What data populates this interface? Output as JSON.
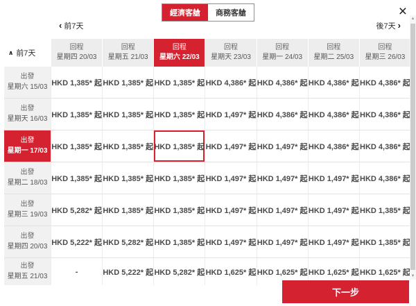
{
  "modal": {
    "tabs": {
      "economy": "經濟客艙",
      "business": "商務客艙"
    },
    "close_icon": "×",
    "nav": {
      "prev_icon": "‹",
      "prev_label": "前7天",
      "next_label": "後7天",
      "next_icon": "›"
    },
    "corner": {
      "collapse_icon": "∧",
      "label": "前7天"
    },
    "next_button_label": "下一步"
  },
  "fare_table": {
    "columns": [
      {
        "type": "回程",
        "date": "星期四 20/03"
      },
      {
        "type": "回程",
        "date": "星期五 21/03"
      },
      {
        "type": "回程",
        "date": "星期六 22/03"
      },
      {
        "type": "回程",
        "date": "星期天 23/03"
      },
      {
        "type": "回程",
        "date": "星期一 24/03"
      },
      {
        "type": "回程",
        "date": "星期二 25/03"
      },
      {
        "type": "回程",
        "date": "星期三 26/03"
      }
    ],
    "rows": [
      {
        "type": "出發",
        "date": "星期六 15/03",
        "prices": [
          "HKD 1,385* 起",
          "HKD 1,385* 起",
          "HKD 1,385* 起",
          "HKD 4,386* 起",
          "HKD 4,386* 起",
          "HKD 4,386* 起",
          "HKD 4,386* 起"
        ]
      },
      {
        "type": "出發",
        "date": "星期天 16/03",
        "prices": [
          "HKD 1,385* 起",
          "HKD 1,385* 起",
          "HKD 1,385* 起",
          "HKD 1,497* 起",
          "HKD 4,386* 起",
          "HKD 4,386* 起",
          "HKD 4,386* 起"
        ]
      },
      {
        "type": "出發",
        "date": "星期一 17/03",
        "prices": [
          "HKD 1,385* 起",
          "HKD 1,385* 起",
          "HKD 1,385* 起",
          "HKD 1,497* 起",
          "HKD 1,497* 起",
          "HKD 4,386* 起",
          "HKD 4,386* 起"
        ]
      },
      {
        "type": "出發",
        "date": "星期二 18/03",
        "prices": [
          "HKD 1,385* 起",
          "HKD 1,385* 起",
          "HKD 1,385* 起",
          "HKD 1,497* 起",
          "HKD 1,497* 起",
          "HKD 1,497* 起",
          "HKD 4,386* 起"
        ]
      },
      {
        "type": "出發",
        "date": "星期三 19/03",
        "prices": [
          "HKD 5,282* 起",
          "HKD 1,385* 起",
          "HKD 1,385* 起",
          "HKD 1,497* 起",
          "HKD 1,497* 起",
          "HKD 1,497* 起",
          "HKD 1,385* 起"
        ]
      },
      {
        "type": "出發",
        "date": "星期四 20/03",
        "prices": [
          "HKD 5,222* 起",
          "HKD 5,282* 起",
          "HKD 1,385* 起",
          "HKD 1,497* 起",
          "HKD 1,497* 起",
          "HKD 1,497* 起",
          "HKD 1,385* 起"
        ]
      },
      {
        "type": "出發",
        "date": "星期五 21/03",
        "prices": [
          "-",
          "HKD 5,222* 起",
          "HKD 5,282* 起",
          "HKD 1,625* 起",
          "HKD 1,625* 起",
          "HKD 1,625* 起",
          "HKD 1,625* 起"
        ]
      }
    ],
    "selected_column_index": 2,
    "selected_row_index": 2,
    "selected_cell": {
      "row": 2,
      "col": 2,
      "value": "HKD 1,385* 起"
    }
  },
  "colors": {
    "accent_red": "#d42230",
    "header_bg": "#ededed",
    "row_header_bg": "#f1f1f1",
    "price_text": "#4a4a4a"
  }
}
